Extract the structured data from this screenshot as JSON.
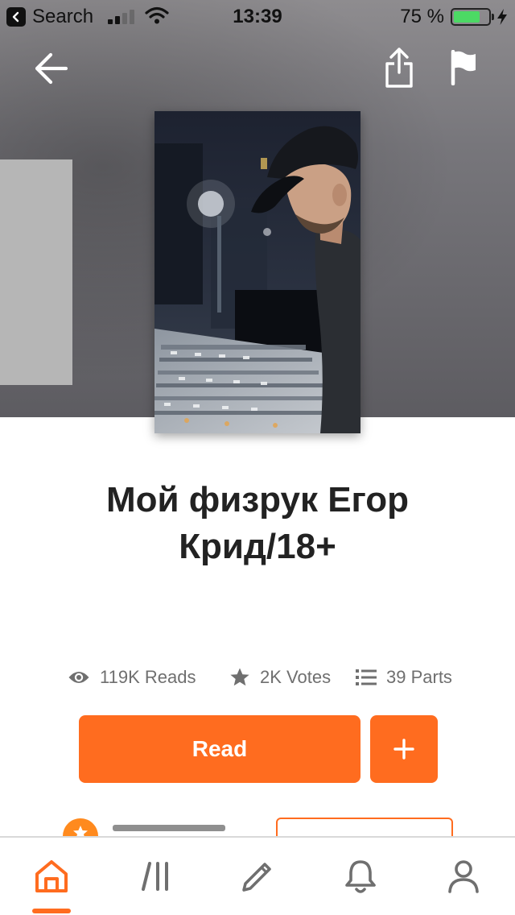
{
  "status_bar": {
    "back_app": "Search",
    "time": "13:39",
    "battery_percent": "75 %",
    "battery_level": 0.75,
    "signal_bars_active": 2,
    "icons": [
      "back-arrow-chip-icon",
      "cellular-signal-icon",
      "wifi-icon",
      "battery-icon",
      "charging-bolt-icon"
    ]
  },
  "top_nav": {
    "icons": [
      "back-arrow-icon",
      "share-icon",
      "flag-icon"
    ]
  },
  "story": {
    "title": "Мой физрук Егор Крид/18+"
  },
  "stats": {
    "reads": "119K Reads",
    "votes": "2K Votes",
    "parts": "39 Parts",
    "icons": [
      "eye-icon",
      "star-icon",
      "list-icon"
    ]
  },
  "actions": {
    "read_label": "Read",
    "add_label": "+"
  },
  "tab_bar": {
    "active": "home",
    "tabs": [
      "home",
      "library",
      "write",
      "notifications",
      "profile"
    ]
  },
  "colors": {
    "accent": "#ff6c1f",
    "title_text": "#222222",
    "stat_text": "#6f6f6f",
    "tab_icon": "#6f6f6f",
    "battery_green": "#4cd964"
  }
}
